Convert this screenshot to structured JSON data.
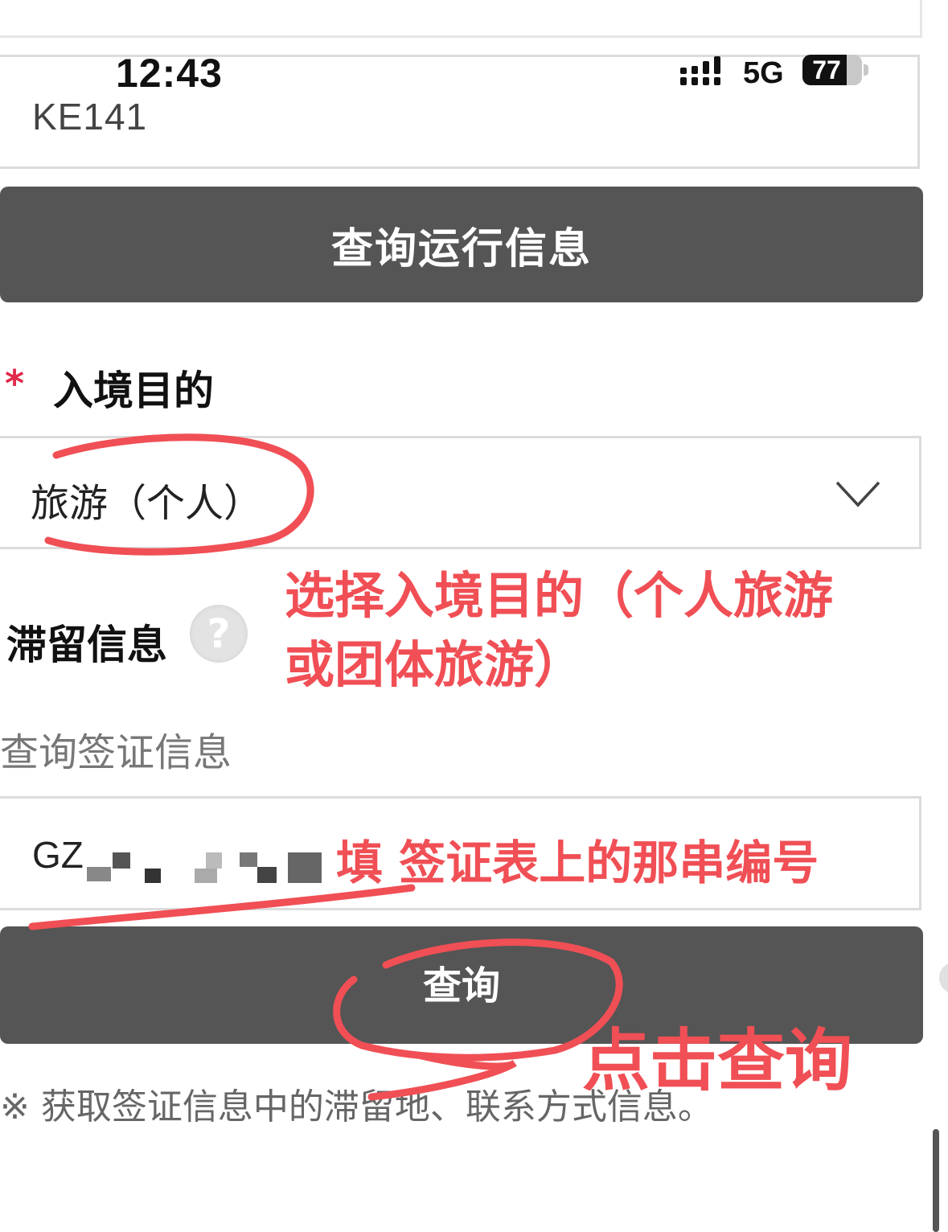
{
  "status_bar": {
    "time": "12:43",
    "network": "5G",
    "battery": "77"
  },
  "flight": {
    "value": "KE141"
  },
  "buttons": {
    "query_flight": "查询运行信息",
    "query": "查询"
  },
  "purpose": {
    "required_mark": "*",
    "label": "入境目的",
    "selected": "旅游（个人）"
  },
  "stay": {
    "label": "滞留信息",
    "help_glyph": "?"
  },
  "visa": {
    "label": "查询签证信息",
    "value_prefix": "GZ"
  },
  "note": "※ 获取签证信息中的滞留地、联系方式信息。",
  "annotations": {
    "purpose_line1": "选择入境目的（个人旅游",
    "purpose_line2": "或团体旅游）",
    "visa": "填 签证表上的那串编号",
    "click": "点击查询",
    "color": "#f04f55"
  },
  "colors": {
    "button_bg": "#555555",
    "required": "#e0294a"
  }
}
